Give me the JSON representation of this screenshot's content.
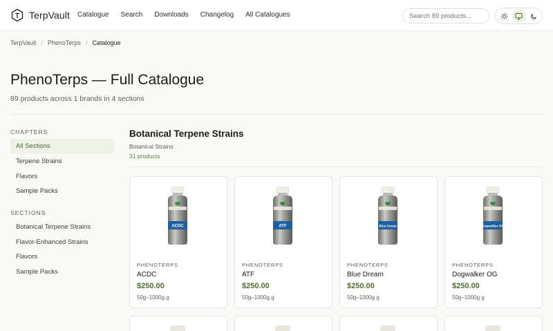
{
  "header": {
    "brand": "TerpVault",
    "nav": [
      "Catalogue",
      "Search",
      "Downloads",
      "Changelog",
      "All Catalogues"
    ],
    "search_placeholder": "Search 89 products..."
  },
  "breadcrumb": [
    "TerpVault",
    "PhenoTerps",
    "Catalogue"
  ],
  "page": {
    "title": "PhenoTerps — Full Catalogue",
    "subtitle": "89 products across 1 brands in 4 sections"
  },
  "sidebar": {
    "chapters_heading": "CHAPTERS",
    "chapters": [
      "All Sections",
      "Terpene Strains",
      "Flavors",
      "Sample Packs"
    ],
    "sections_heading": "SECTIONS",
    "sections": [
      "Botanical Terpene Strains",
      "Flavor-Enhanced Strains",
      "Flavors",
      "Sample Packs"
    ]
  },
  "section": {
    "title": "Botanical Terpene Strains",
    "subtitle": "Botanical Strains",
    "count": "31 products"
  },
  "products": [
    {
      "brand": "PHENOTERPS",
      "name": "ACDC",
      "label": "ACDC",
      "price": "$250.00",
      "size": "50g–1000g g"
    },
    {
      "brand": "PHENOTERPS",
      "name": "ATF",
      "label": "ATF",
      "price": "$250.00",
      "size": "50g–1000g g"
    },
    {
      "brand": "PHENOTERPS",
      "name": "Blue Dream",
      "label": "Blue Dream",
      "price": "$250.00",
      "size": "50g–1000g g"
    },
    {
      "brand": "PHENOTERPS",
      "name": "Dogwalker OG",
      "label": "Dogwalker OG",
      "price": "$250.00",
      "size": "50g–1000g g"
    }
  ],
  "colors": {
    "accent": "#4f6a2f",
    "active_bg": "#eef1e6",
    "label_blue": "#1d5fa0"
  },
  "icons": [
    "terpvault-logo-icon",
    "sun-icon",
    "monitor-icon",
    "moon-icon"
  ]
}
